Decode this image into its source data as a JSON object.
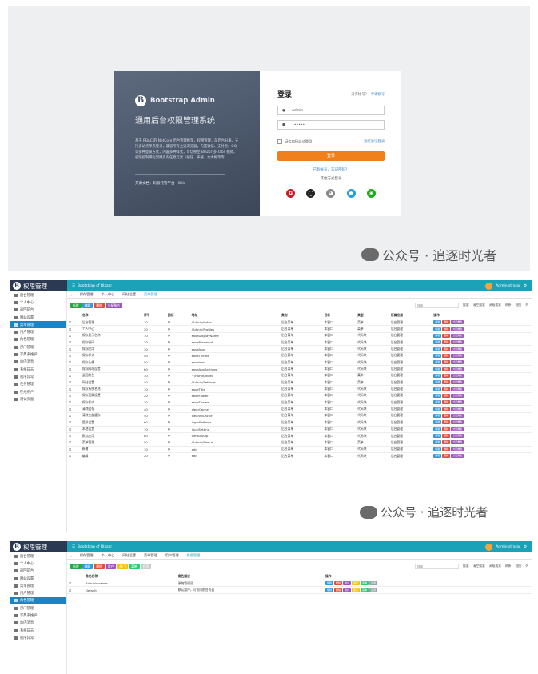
{
  "login": {
    "brand": "Bootstrap Admin",
    "subtitle": "通用后台权限管理系统",
    "desc": "基于 RBAC 的 NetCore 后台管理框架，权限管理，前后台分离，支持多站点单点登录，兼容所有主流浏览器，内置微信、支付宝、QQ等多种登录方式，内置多种样式，可切换至 Blazor 多 Tabs 模式，权限控制细化到网页内任意元素（按钮、表格、文本框等等）",
    "doc_label": "开源文档：",
    "doc_link": "码云托管平台 · Wiki",
    "title": "登录",
    "no_account": "没有帐号？",
    "register": "申请帐号",
    "username": "Admin",
    "password": "••••••",
    "remember": "记住密码自动登录",
    "mobile_login": "短信验证登录",
    "login_btn": "登录",
    "forgot": "已有帐号，忘记密码？",
    "other": "其他方式登录",
    "socials": [
      {
        "icon": "gitee-icon",
        "color": "#c71d23",
        "glyph": "G"
      },
      {
        "icon": "github-icon",
        "color": "#222222",
        "glyph": "◯"
      },
      {
        "icon": "weibo-icon",
        "color": "#888888",
        "glyph": "◕"
      },
      {
        "icon": "qq-icon",
        "color": "#1e9cf0",
        "glyph": "●"
      },
      {
        "icon": "wechat-icon",
        "color": "#1aad19",
        "glyph": "◉"
      }
    ]
  },
  "watermark": "公众号 · 追逐时光者",
  "admin": {
    "app": "权限管理",
    "site": "Bootstrap of Blazor",
    "user": "Administrator",
    "sidebar1": [
      "后台管理",
      "个人中心",
      "返回前台",
      "网站设置",
      "菜单管理",
      "用户管理",
      "角色管理",
      "部门管理",
      "字典表维护",
      "站内消息",
      "系统日志",
      "程序异常",
      "任务管理",
      "在线用户",
      "测试页面"
    ],
    "sidebar1_active": 4,
    "tabs1": [
      "保存管理",
      "个人中心",
      "网站设置",
      "菜单管理"
    ],
    "tabs1_active": 3,
    "tools1": [
      {
        "l": "新增",
        "c": "#28a745"
      },
      {
        "l": "编辑",
        "c": "#3498db"
      },
      {
        "l": "删除",
        "c": "#e74c3c"
      },
      {
        "l": "分配角色",
        "c": "#9b59b6"
      }
    ],
    "search_ph": "搜索",
    "rtools": [
      "搜索",
      "清空搜索",
      "高级搜索",
      "刷新",
      "视图",
      "列"
    ],
    "cols1": [
      "名称",
      "序号",
      "图标",
      "地址",
      "类别",
      "目标",
      "类型",
      "所属应用",
      "操作"
    ],
    "rows1": [
      [
        "后台管理",
        "10",
        "/Admin/Index",
        "后台菜单",
        "本窗口",
        "菜单",
        "后台管理"
      ],
      [
        "个人中心",
        "20",
        "/Admin/Profiles",
        "后台菜单",
        "本窗口",
        "菜单",
        "后台管理"
      ],
      [
        "保存显示名称",
        "10",
        "saveDisplayName",
        "后台菜单",
        "本窗口",
        "代码块",
        "后台管理"
      ],
      [
        "保存密码",
        "20",
        "savePassword",
        "后台菜单",
        "本窗口",
        "代码块",
        "后台管理"
      ],
      [
        "保存应用",
        "30",
        "saveApp",
        "后台菜单",
        "本窗口",
        "代码块",
        "后台管理"
      ],
      [
        "保存样式",
        "40",
        "saveTheme",
        "后台菜单",
        "本窗口",
        "代码块",
        "后台管理"
      ],
      [
        "保存头像",
        "50",
        "saveIcon",
        "后台菜单",
        "本窗口",
        "代码块",
        "后台管理"
      ],
      [
        "保存网站设置",
        "60",
        "saveAppSettings",
        "后台菜单",
        "本窗口",
        "代码块",
        "后台管理"
      ],
      [
        "返回前台",
        "30",
        "~/Home/Index",
        "后台菜单",
        "本窗口",
        "菜单",
        "后台管理"
      ],
      [
        "网站设置",
        "40",
        "/Admin/Settings",
        "后台菜单",
        "本窗口",
        "菜单",
        "后台管理"
      ],
      [
        "保存系统名称",
        "10",
        "saveTitle",
        "后台菜单",
        "本窗口",
        "代码块",
        "后台管理"
      ],
      [
        "保存页脚设置",
        "20",
        "saveFooter",
        "后台菜单",
        "本窗口",
        "代码块",
        "后台管理"
      ],
      [
        "保存样式",
        "30",
        "saveTheme",
        "后台菜单",
        "本窗口",
        "代码块",
        "后台管理"
      ],
      [
        "清除缓存",
        "40",
        "clearCache",
        "后台菜单",
        "本窗口",
        "代码块",
        "后台管理"
      ],
      [
        "清除全部缓存",
        "50",
        "clearAllCache",
        "后台菜单",
        "本窗口",
        "代码块",
        "后台管理"
      ],
      [
        "登录设置",
        "60",
        "loginSettings",
        "后台菜单",
        "本窗口",
        "代码块",
        "后台管理"
      ],
      [
        "本地设置",
        "70",
        "localSetting",
        "后台菜单",
        "本窗口",
        "代码块",
        "后台管理"
      ],
      [
        "默认应用",
        "80",
        "defaultApp",
        "后台菜单",
        "本窗口",
        "代码块",
        "后台管理"
      ],
      [
        "菜单管理",
        "50",
        "/Admin/Menus",
        "后台菜单",
        "本窗口",
        "菜单",
        "后台管理"
      ],
      [
        "新增",
        "10",
        "add",
        "后台菜单",
        "本窗口",
        "代码块",
        "后台管理"
      ],
      [
        "编辑",
        "20",
        "edit",
        "后台菜单",
        "本窗口",
        "代码块",
        "后台管理"
      ]
    ],
    "row_actions": [
      {
        "l": "编辑",
        "c": "#3498db"
      },
      {
        "l": "删除",
        "c": "#e74c3c"
      },
      {
        "l": "分配角色",
        "c": "#9b59b6"
      }
    ],
    "sidebar2": [
      "后台管理",
      "个人中心",
      "返回前台",
      "网站设置",
      "菜单管理",
      "用户管理",
      "角色管理",
      "部门管理",
      "字典表维护",
      "站内消息",
      "系统日志",
      "程序异常"
    ],
    "sidebar2_active": 6,
    "tabs2": [
      "保存管理",
      "个人中心",
      "网站设置",
      "菜单管理",
      "用户管理",
      "角色管理"
    ],
    "tabs2_active": 5,
    "tools2": [
      {
        "l": "新增",
        "c": "#28a745"
      },
      {
        "l": "编辑",
        "c": "#3498db"
      },
      {
        "l": "删除",
        "c": "#e74c3c"
      },
      {
        "l": "用户",
        "c": "#9b59b6"
      },
      {
        "l": "部门",
        "c": "#f1c40f"
      },
      {
        "l": "菜单",
        "c": "#2ecc71"
      },
      {
        "l": "应用",
        "c": "#cccccc"
      }
    ],
    "cols2": [
      "角色名称",
      "角色描述",
      "操作"
    ],
    "rows2": [
      [
        "Administrators",
        "系统管理员"
      ],
      [
        "Default",
        "默认用户，可访问前台页面"
      ]
    ],
    "row_actions2": [
      {
        "l": "编辑",
        "c": "#3498db"
      },
      {
        "l": "删除",
        "c": "#e74c3c"
      },
      {
        "l": "用户",
        "c": "#9b59b6"
      },
      {
        "l": "部门",
        "c": "#f1c40f"
      },
      {
        "l": "菜单",
        "c": "#2ecc71"
      },
      {
        "l": "应用",
        "c": "#95a5a6"
      }
    ]
  }
}
